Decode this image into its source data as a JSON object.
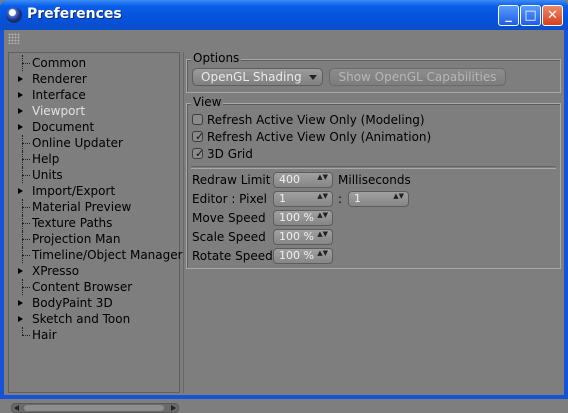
{
  "window": {
    "title": "Preferences",
    "minimize_glyph": "_",
    "maximize_glyph": "□",
    "close_glyph": "✕"
  },
  "sidebar": {
    "items": [
      {
        "label": "Common",
        "expandable": false
      },
      {
        "label": "Renderer",
        "expandable": true
      },
      {
        "label": "Interface",
        "expandable": true
      },
      {
        "label": "Viewport",
        "expandable": true,
        "selected": true
      },
      {
        "label": "Document",
        "expandable": true
      },
      {
        "label": "Online Updater",
        "expandable": false
      },
      {
        "label": "Help",
        "expandable": false
      },
      {
        "label": "Units",
        "expandable": false
      },
      {
        "label": "Import/Export",
        "expandable": true
      },
      {
        "label": "Material Preview",
        "expandable": false
      },
      {
        "label": "Texture Paths",
        "expandable": false
      },
      {
        "label": "Projection Man",
        "expandable": false
      },
      {
        "label": "Timeline/Object Manager",
        "expandable": false
      },
      {
        "label": "XPresso",
        "expandable": true
      },
      {
        "label": "Content Browser",
        "expandable": false
      },
      {
        "label": "BodyPaint 3D",
        "expandable": true
      },
      {
        "label": "Sketch and Toon",
        "expandable": true
      },
      {
        "label": "Hair",
        "expandable": false
      }
    ]
  },
  "options": {
    "title": "Options",
    "shading_value": "OpenGL Shading",
    "capabilities_label": "Show OpenGL Capabilities"
  },
  "view": {
    "title": "View",
    "refresh_modeling": {
      "label": "Refresh Active View Only (Modeling)",
      "checked": false
    },
    "refresh_animation": {
      "label": "Refresh Active View Only (Animation)",
      "checked": true
    },
    "grid_3d": {
      "label": "3D Grid",
      "checked": true
    },
    "check_glyph": "✓",
    "redraw_limit": {
      "label": "Redraw Limit",
      "value": "400",
      "unit": "Milliseconds"
    },
    "editor_pixel": {
      "label": "Editor : Pixel",
      "value1": "1",
      "separator": ":",
      "value2": "1"
    },
    "move_speed": {
      "label": "Move Speed",
      "value": "100 %"
    },
    "scale_speed": {
      "label": "Scale Speed",
      "value": "100 %"
    },
    "rotate_speed": {
      "label": "Rotate Speed",
      "value": "100 %"
    },
    "spin_glyph": "▲▼"
  },
  "colors": {
    "titlebar": "#0552dc",
    "background": "#7e7e7e",
    "close_button": "#d5401d",
    "selected_text": "#e2e2e2"
  }
}
